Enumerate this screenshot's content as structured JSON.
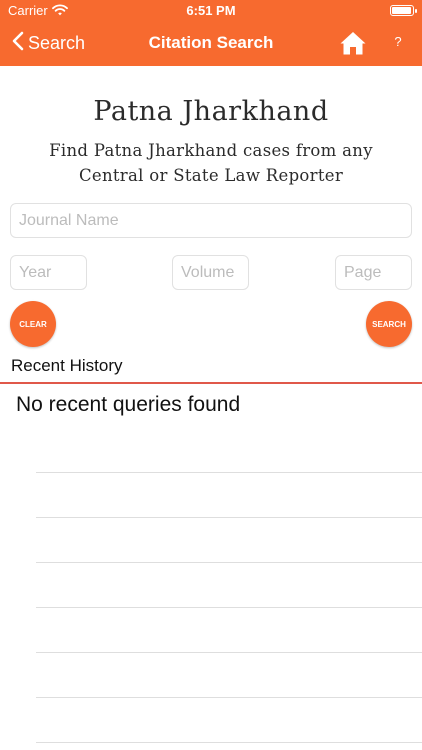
{
  "status_bar": {
    "carrier": "Carrier",
    "time": "6:51 PM",
    "battery_level": 0.95
  },
  "nav": {
    "back_label": "Search",
    "title": "Citation Search",
    "help_label": "?"
  },
  "brand": {
    "title": "Patna Jharkhand",
    "tagline_line1": "Find Patna Jharkhand cases from any",
    "tagline_line2": "Central or State Law Reporter"
  },
  "form": {
    "journal_placeholder": "Journal Name",
    "year_placeholder": "Year",
    "volume_placeholder": "Volume",
    "page_placeholder": "Page",
    "clear_label": "CLEAR",
    "search_label": "SEARCH"
  },
  "history": {
    "heading": "Recent History",
    "empty_message": "No recent queries found"
  },
  "colors": {
    "accent": "#f76a2f",
    "divider": "#e0584a"
  }
}
